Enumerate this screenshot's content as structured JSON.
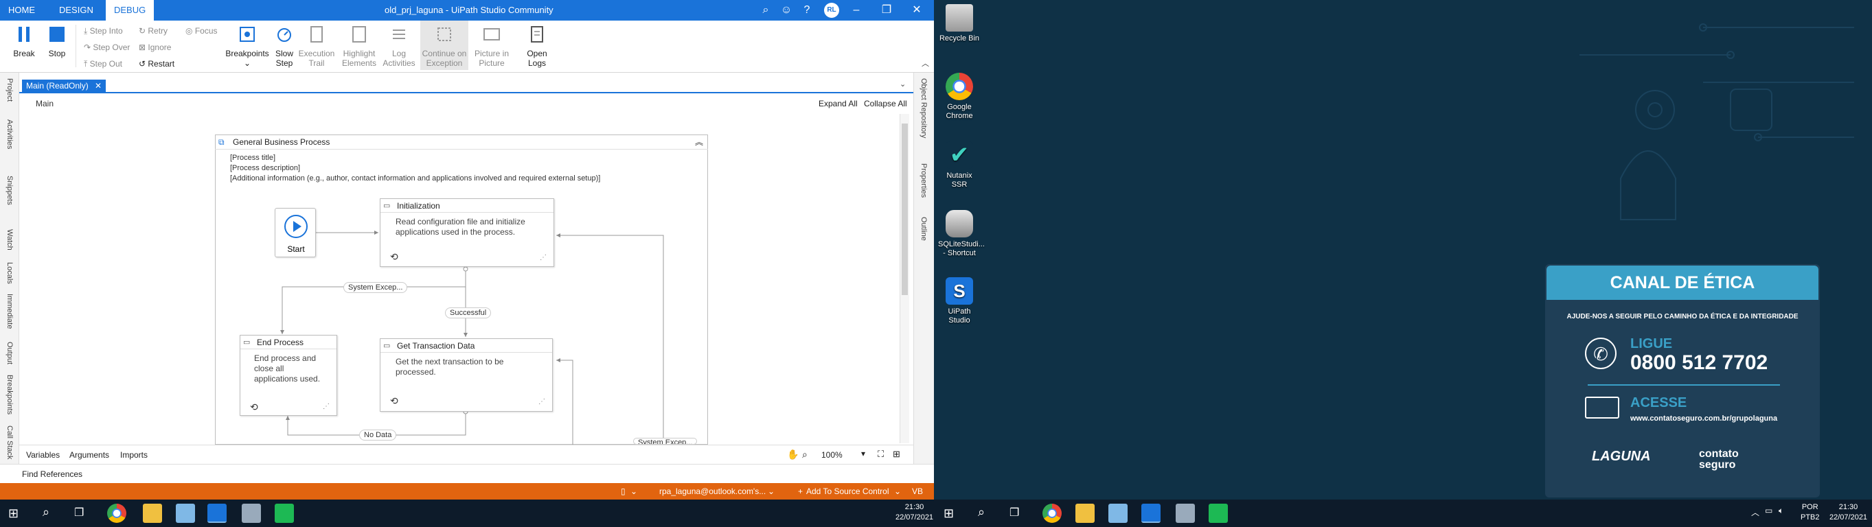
{
  "studio": {
    "ribbon_tabs": [
      "HOME",
      "DESIGN",
      "DEBUG"
    ],
    "window_title": "old_prj_laguna - UiPath Studio Community",
    "user_initials": "RL",
    "ribbon": {
      "break": "Break",
      "stop": "Stop",
      "step_into": "Step Into",
      "step_over": "Step Over",
      "step_out": "Step Out",
      "retry": "Retry",
      "ignore": "Ignore",
      "restart": "Restart",
      "focus": "Focus",
      "breakpoints": "Breakpoints",
      "slow_step": [
        "Slow",
        "Step"
      ],
      "execution_trail": [
        "Execution",
        "Trail"
      ],
      "highlight_elements": [
        "Highlight",
        "Elements"
      ],
      "log_activities": [
        "Log",
        "Activities"
      ],
      "continue_on_exception": [
        "Continue on",
        "Exception"
      ],
      "picture_in_picture": [
        "Picture in",
        "Picture"
      ],
      "open_logs": [
        "Open",
        "Logs"
      ]
    },
    "left_panels": [
      "Project",
      "Activities",
      "Snippets",
      "Watch",
      "Locals",
      "Immediate",
      "Output",
      "Breakpoints",
      "Call Stack"
    ],
    "right_panels": [
      "Object Repository",
      "Properties",
      "Outline"
    ],
    "doc_tab": "Main (ReadOnly)",
    "breadcrumb": "Main",
    "expand_all": "Expand All",
    "collapse_all": "Collapse All",
    "sequence": {
      "title": "General Business Process",
      "annotations": [
        "[Process title]",
        "[Process description]",
        "[Additional information (e.g., author, contact information and applications involved and required external setup)]"
      ],
      "start_label": "Start",
      "states": [
        {
          "title": "Initialization",
          "body": "Read configuration file and initialize applications used in the process."
        },
        {
          "title": "End Process",
          "body": "End process and close all applications used."
        },
        {
          "title": "Get Transaction Data",
          "body": "Get the next transaction to be processed."
        }
      ],
      "transitions": [
        "System Excep...",
        "Successful",
        "No Data",
        "System Excep..."
      ]
    },
    "bottom_tabs": [
      "Variables",
      "Arguments",
      "Imports"
    ],
    "zoom": "100%",
    "find_references": "Find References",
    "status": {
      "account": "rpa_laguna@outlook.com's...",
      "source_control": "Add To Source Control",
      "language": "VB"
    },
    "clock": {
      "time": "21:30",
      "date": "22/07/2021"
    }
  },
  "desktop": {
    "icons": [
      {
        "label": "Recycle Bin",
        "icon": "recycle-bin-icon"
      },
      {
        "label": "Google Chrome",
        "icon": "chrome-icon"
      },
      {
        "label": "Nutanix SSR",
        "icon": "nutanix-icon"
      },
      {
        "label": "SQLiteStudi... - Shortcut",
        "icon": "database-icon"
      },
      {
        "label": "UiPath Studio",
        "icon": "uipath-icon"
      }
    ],
    "wallpaper": {
      "title": "CANAL DE ÉTICA",
      "subtitle": "AJUDE-NOS A SEGUIR PELO CAMINHO DA ÉTICA E DA INTEGRIDADE",
      "call_label": "LIGUE",
      "phone": "0800 512 7702",
      "access_label": "ACESSE",
      "url": "www.contatoseguro.com.br/grupolaguna",
      "logo_left": "LAGUNA",
      "logo_right": "contato seguro"
    },
    "tray": {
      "lang": "POR",
      "layout": "PTB2",
      "time": "21:30",
      "date": "22/07/2021"
    }
  },
  "colors": {
    "accent": "#1a73d9",
    "status_orange": "#e1640f",
    "taskbar": "#0d1b2a",
    "wallpaper": "#0f3146",
    "etica_header": "#3aa0c7"
  }
}
